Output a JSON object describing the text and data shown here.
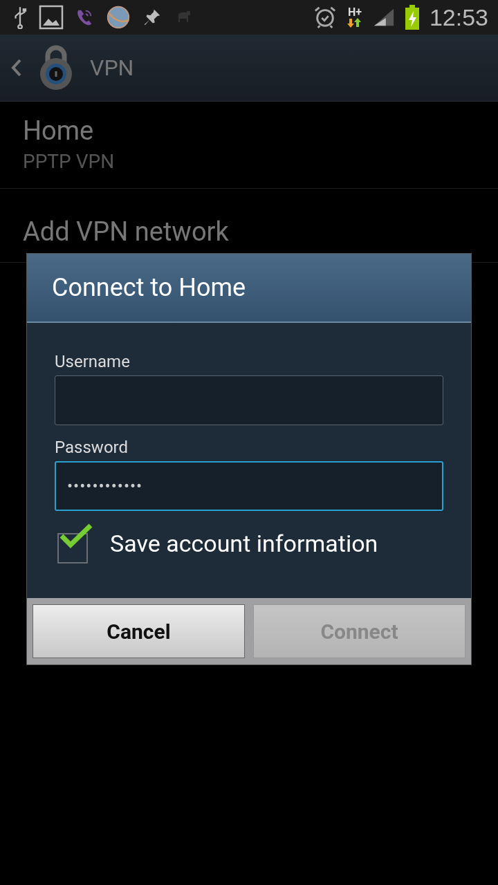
{
  "status_bar": {
    "network_type": "H+",
    "time": "12:53"
  },
  "action_bar": {
    "title": "VPN"
  },
  "vpn_list": [
    {
      "name": "Home",
      "type": "PPTP VPN"
    },
    {
      "name": "Add VPN network"
    }
  ],
  "dialog": {
    "title": "Connect to Home",
    "fields": [
      {
        "label": "Username",
        "focused": false
      },
      {
        "label": "Password",
        "value": "••••••••••••",
        "focused": true
      }
    ],
    "checkbox": {
      "label": "Save account information",
      "checked": true
    },
    "buttons": [
      {
        "label": "Cancel",
        "disabled": false
      },
      {
        "label": "Connect",
        "disabled": true
      }
    ]
  }
}
